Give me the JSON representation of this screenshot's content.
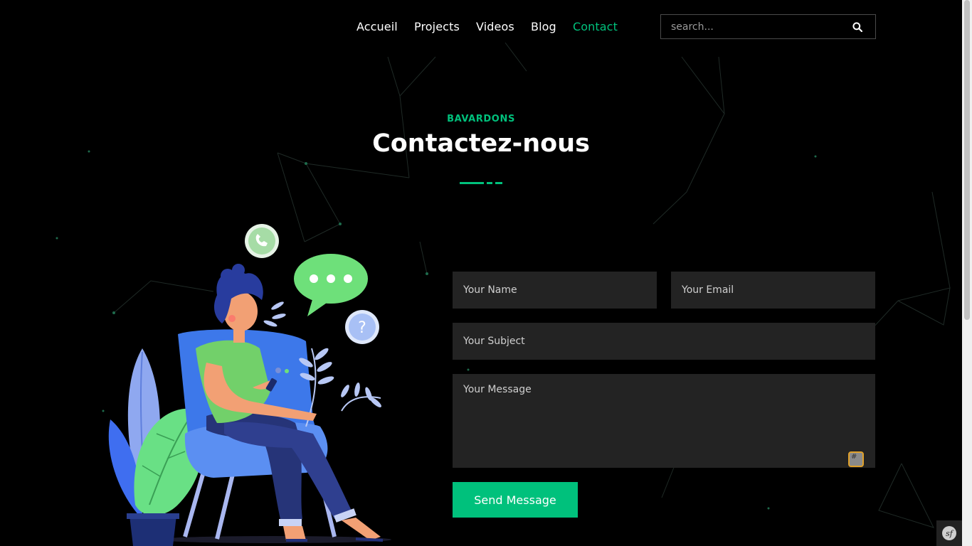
{
  "nav": {
    "items": [
      {
        "label": "Accueil",
        "active": false
      },
      {
        "label": "Projects",
        "active": false
      },
      {
        "label": "Videos",
        "active": false
      },
      {
        "label": "Blog",
        "active": false
      },
      {
        "label": "Contact",
        "active": true
      }
    ]
  },
  "search": {
    "placeholder": "search...",
    "icon": "search-icon"
  },
  "section": {
    "eyebrow": "BAVARDONS",
    "title": "Contactez-nous"
  },
  "form": {
    "name_placeholder": "Your Name",
    "email_placeholder": "Your Email",
    "subject_placeholder": "Your Subject",
    "message_placeholder": "Your Message",
    "submit_label": "Send Message"
  },
  "colors": {
    "accent": "#00c17c",
    "background": "#000000",
    "field": "#232323"
  }
}
